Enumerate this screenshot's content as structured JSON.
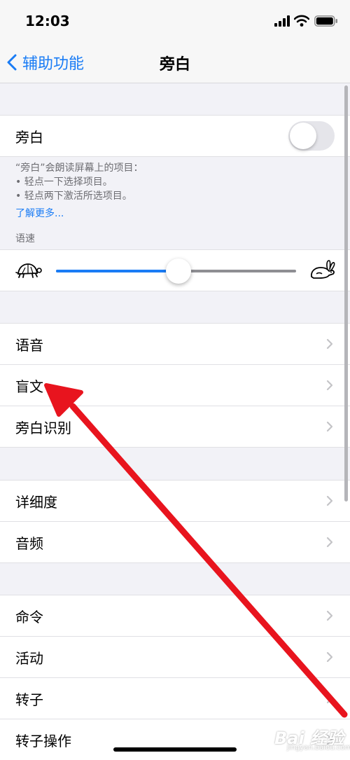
{
  "status": {
    "time": "12:03"
  },
  "nav": {
    "back_label": "辅助功能",
    "title": "旁白"
  },
  "voiceover": {
    "label": "旁白",
    "enabled": false
  },
  "description": {
    "intro": "“旁白”会朗读屏幕上的项目：",
    "bullets": [
      "• 轻点一下选择项目。",
      "• 轻点两下激活所选项目。"
    ],
    "learn_more": "了解更多..."
  },
  "speaking_rate": {
    "header": "语速",
    "value_percent": 51
  },
  "group1": [
    {
      "label": "语音"
    },
    {
      "label": "盲文"
    },
    {
      "label": "旁白识别"
    }
  ],
  "group2": [
    {
      "label": "详细度"
    },
    {
      "label": "音频"
    }
  ],
  "group3": [
    {
      "label": "命令"
    },
    {
      "label": "活动"
    },
    {
      "label": "转子"
    },
    {
      "label": "转子操作"
    }
  ],
  "watermark": {
    "logo": "Bai 经验",
    "url": "jingyan.baidu.com"
  },
  "colors": {
    "accent": "#1a7cf5",
    "annotation_arrow": "#e8141e"
  }
}
